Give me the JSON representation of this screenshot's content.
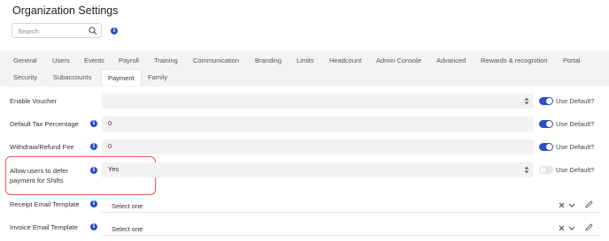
{
  "page": {
    "title": "Organization Settings"
  },
  "search": {
    "placeholder": "Search",
    "value": ""
  },
  "tabs_row1": [
    {
      "label": "General"
    },
    {
      "label": "Users"
    },
    {
      "label": "Events"
    },
    {
      "label": "Payroll"
    },
    {
      "label": "Training"
    },
    {
      "label": "Communication"
    },
    {
      "label": "Branding"
    },
    {
      "label": "Limits"
    },
    {
      "label": "Headcount"
    },
    {
      "label": "Admin Console"
    },
    {
      "label": "Advanced"
    },
    {
      "label": "Rewards & recognition"
    },
    {
      "label": "Portal"
    }
  ],
  "tabs_row2": [
    {
      "label": "Security"
    },
    {
      "label": "Subaccounts"
    },
    {
      "label": "Payment",
      "active": true
    },
    {
      "label": "Family"
    }
  ],
  "settings": [
    {
      "label": "Enable Voucher",
      "value": "",
      "type": "select",
      "use_default": true
    },
    {
      "label": "Default Tax Percentage",
      "value": "0",
      "type": "input",
      "use_default": true
    },
    {
      "label": "Withdraw/Refund Fee",
      "value": "0",
      "type": "input",
      "use_default": true
    },
    {
      "label_line1": "Allow users to defer",
      "label_line2": "payment for Shifts",
      "value": "Yes",
      "type": "select",
      "use_default": false
    }
  ],
  "use_default_label": "Use Default?",
  "templates": [
    {
      "label": "Receipt Email Template",
      "value": "Select one"
    },
    {
      "label": "Invoice Email Template",
      "value": "Select one"
    }
  ],
  "colors": {
    "accent": "#2d4fc4",
    "highlight": "#e05a52",
    "field_bg": "#f2f2f2",
    "tab_bg": "#f3f3f3"
  }
}
